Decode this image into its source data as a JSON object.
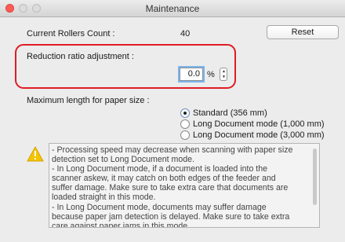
{
  "window": {
    "title": "Maintenance"
  },
  "rollers": {
    "label": "Current Rollers Count :",
    "value": "40",
    "reset_label": "Reset"
  },
  "reduction": {
    "label": "Reduction ratio adjustment :",
    "value": "0.0",
    "unit": "%"
  },
  "paper": {
    "label": "Maximum length for paper size :",
    "options": [
      {
        "label": "Standard (356 mm)",
        "selected": true
      },
      {
        "label": "Long Document mode (1,000 mm)",
        "selected": false
      },
      {
        "label": "Long Document mode (3,000 mm)",
        "selected": false
      }
    ]
  },
  "notes": {
    "icon": "warning-icon",
    "lines": [
      "- Processing speed may decrease when scanning with paper size",
      "detection set to Long Document mode.",
      "- In Long Document mode, if a document is loaded into the",
      "scanner askew, it may catch on both edges of the feeder and",
      "suffer damage. Make sure to take extra care that documents are",
      "loaded straight in this mode.",
      "- In Long Document mode, documents may suffer damage",
      "because paper jam detection is delayed. Make sure to take extra",
      "care against paper jams in this mode."
    ]
  },
  "colors": {
    "highlight": "#e01b24",
    "warning": "#f5c400",
    "focus": "#7ab5ee"
  }
}
